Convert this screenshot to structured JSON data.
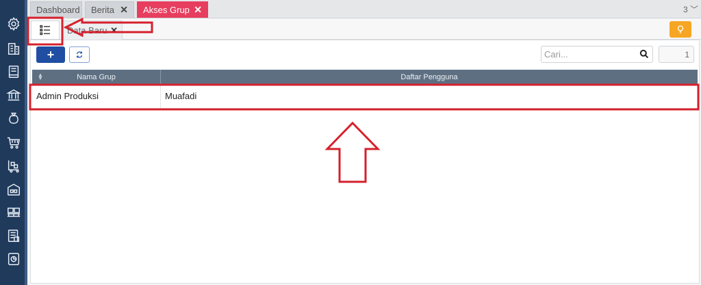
{
  "tabs": [
    {
      "label": "Dashboard",
      "closable": false,
      "active": false
    },
    {
      "label": "Berita",
      "closable": true,
      "active": false
    },
    {
      "label": "Akses Grup",
      "closable": true,
      "active": true
    }
  ],
  "tab_close_glyph": "✕",
  "tab_count": "3",
  "subtab": {
    "label": "Data Baru",
    "close_glyph": "✕"
  },
  "toolbar": {
    "add_label": "+",
    "search_placeholder": "Cari...",
    "page_number": "1"
  },
  "table": {
    "columns": [
      "Nama Grup",
      "Daftar Pengguna"
    ],
    "rows": [
      {
        "nama_grup": "Admin Produksi",
        "daftar_pengguna": "Muafadi"
      }
    ]
  },
  "sidebar_icons": [
    "gear-icon",
    "building-icon",
    "book-icon",
    "bank-icon",
    "money-bag-icon",
    "cart-icon",
    "trolley-icon",
    "warehouse-icon",
    "pallet-icon",
    "tax-document-icon",
    "report-icon"
  ],
  "colors": {
    "sidebar": "#203a5c",
    "active_tab": "#e73e5f",
    "primary_button": "#1f4ea3",
    "accent_button": "#f6a623",
    "table_header": "#5e6f81",
    "annotation": "#d6202c"
  }
}
